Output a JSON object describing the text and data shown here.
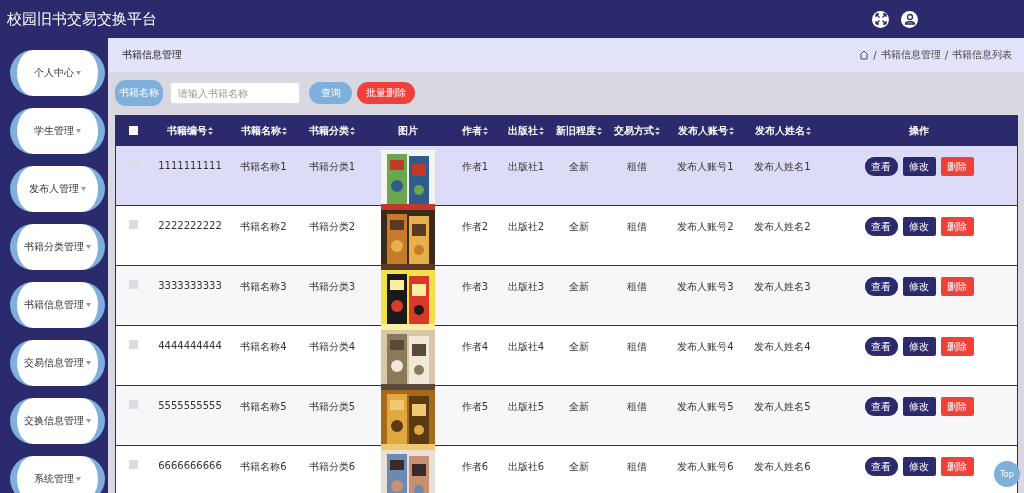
{
  "header": {
    "title": "校园旧书交易交换平台"
  },
  "sidebar": {
    "items": [
      {
        "label": "个人中心"
      },
      {
        "label": "学生管理"
      },
      {
        "label": "发布人管理"
      },
      {
        "label": "书籍分类管理"
      },
      {
        "label": "书籍信息管理"
      },
      {
        "label": "交易信息管理"
      },
      {
        "label": "交换信息管理"
      },
      {
        "label": "系统管理"
      }
    ]
  },
  "page_title": "书籍信息管理",
  "breadcrumb": [
    {
      "separator": "/",
      "label": "书籍信息管理"
    },
    {
      "separator": "/",
      "label": "书籍信息列表"
    }
  ],
  "search": {
    "label": "书籍名称",
    "placeholder": "请输入书籍名称",
    "buttons": [
      {
        "label": "查询",
        "kind": "query"
      },
      {
        "label": "批量删除",
        "kind": "danger"
      }
    ]
  },
  "table": {
    "select_all": {
      "checked": false
    },
    "columns": [
      {
        "label": "书籍编号",
        "sortable": true,
        "kind": "text"
      },
      {
        "label": "书籍名称",
        "sortable": true,
        "kind": "text"
      },
      {
        "label": "书籍分类",
        "sortable": true,
        "kind": "text"
      },
      {
        "label": "图片",
        "sortable": false,
        "kind": "picture"
      },
      {
        "label": "作者",
        "sortable": true,
        "kind": "text"
      },
      {
        "label": "出版社",
        "sortable": true,
        "kind": "text"
      },
      {
        "label": "新旧程度",
        "sortable": true,
        "kind": "text"
      },
      {
        "label": "交易方式",
        "sortable": true,
        "kind": "text"
      },
      {
        "label": "发布人账号",
        "sortable": true,
        "kind": "text"
      },
      {
        "label": "发布人姓名",
        "sortable": true,
        "kind": "text"
      },
      {
        "label": "操作",
        "sortable": false,
        "kind": "actions"
      }
    ],
    "rows": [
      {
        "selected": true,
        "checked": false,
        "cells": [
          "1111111111",
          "书籍名称1",
          "书籍分类1",
          "",
          "作者1",
          "出版社1",
          "全新",
          "租借",
          "发布人账号1",
          "发布人姓名1"
        ],
        "actions": [
          {
            "label": "查看",
            "kind": "view"
          },
          {
            "label": "修改",
            "kind": "edit"
          },
          {
            "label": "删除",
            "kind": "delete"
          }
        ]
      },
      {
        "selected": false,
        "checked": false,
        "cells": [
          "2222222222",
          "书籍名称2",
          "书籍分类2",
          "",
          "作者2",
          "出版社2",
          "全新",
          "租借",
          "发布人账号2",
          "发布人姓名2"
        ],
        "actions": [
          {
            "label": "查看",
            "kind": "view"
          },
          {
            "label": "修改",
            "kind": "edit"
          },
          {
            "label": "删除",
            "kind": "delete"
          }
        ]
      },
      {
        "selected": false,
        "checked": false,
        "cells": [
          "3333333333",
          "书籍名称3",
          "书籍分类3",
          "",
          "作者3",
          "出版社3",
          "全新",
          "租借",
          "发布人账号3",
          "发布人姓名3"
        ],
        "actions": [
          {
            "label": "查看",
            "kind": "view"
          },
          {
            "label": "修改",
            "kind": "edit"
          },
          {
            "label": "删除",
            "kind": "delete"
          }
        ]
      },
      {
        "selected": false,
        "checked": false,
        "cells": [
          "4444444444",
          "书籍名称4",
          "书籍分类4",
          "",
          "作者4",
          "出版社4",
          "全新",
          "租借",
          "发布人账号4",
          "发布人姓名4"
        ],
        "actions": [
          {
            "label": "查看",
            "kind": "view"
          },
          {
            "label": "修改",
            "kind": "edit"
          },
          {
            "label": "删除",
            "kind": "delete"
          }
        ]
      },
      {
        "selected": false,
        "checked": false,
        "cells": [
          "5555555555",
          "书籍名称5",
          "书籍分类5",
          "",
          "作者5",
          "出版社5",
          "全新",
          "租借",
          "发布人账号5",
          "发布人姓名5"
        ],
        "actions": [
          {
            "label": "查看",
            "kind": "view"
          },
          {
            "label": "修改",
            "kind": "edit"
          },
          {
            "label": "删除",
            "kind": "delete"
          }
        ]
      },
      {
        "selected": false,
        "checked": false,
        "cells": [
          "6666666666",
          "书籍名称6",
          "书籍分类6",
          "",
          "作者6",
          "出版社6",
          "全新",
          "租借",
          "发布人账号6",
          "发布人姓名6"
        ],
        "actions": [
          {
            "label": "查看",
            "kind": "view"
          },
          {
            "label": "修改",
            "kind": "edit"
          },
          {
            "label": "删除",
            "kind": "delete"
          }
        ]
      }
    ]
  },
  "back_to_top": "Top"
}
